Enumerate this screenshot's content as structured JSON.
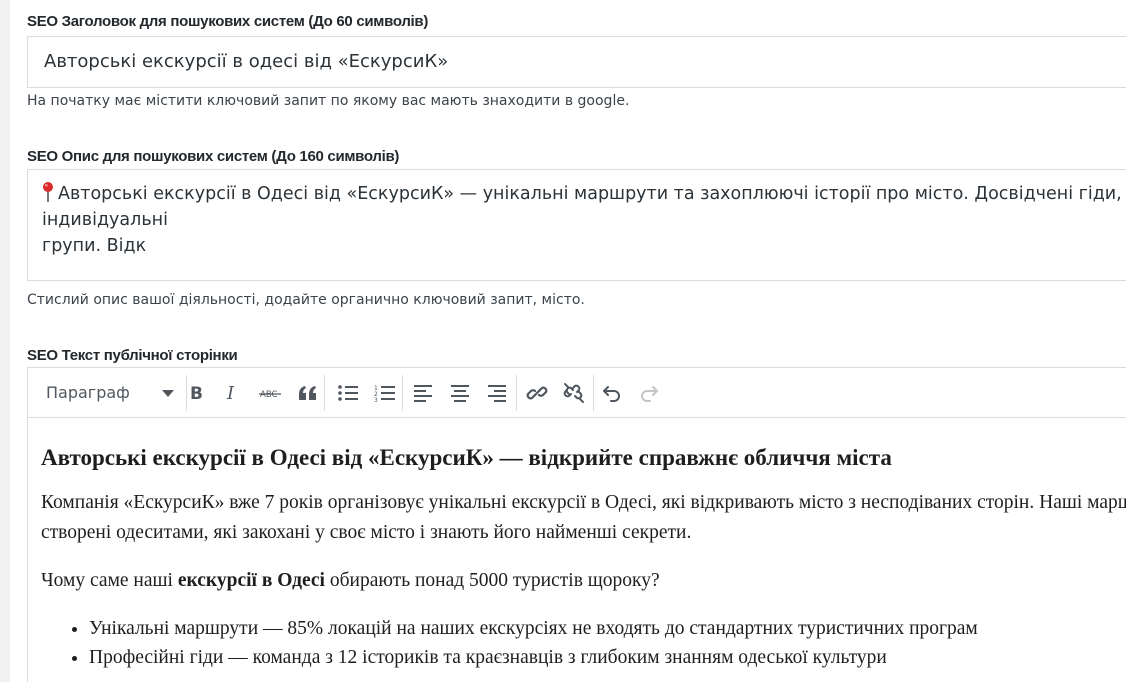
{
  "seo_title": {
    "label": "SEO Заголовок для пошукових систем (До 60 символів)",
    "value": "Авторські екскурсії в одесі від «ЕскурсиК»",
    "help": "На початку має містити ключовий запит по якому вас мають знаходити в google."
  },
  "seo_description": {
    "label": "SEO Опис для пошукових систем (До 160 символів)",
    "icon": "red-pin-icon",
    "value_line1": "Авторські екскурсії в Одесі від «ЕскурсиК» — унікальні маршрути та захоплюючі історії про місто. Досвідчені гіди, індивідуальні",
    "value_line2": "групи. Відк",
    "help": "Стислий опис вашої діяльності, додайте органично ключовий запит, місто."
  },
  "seo_text": {
    "label": "SEO Текст публічної сторінки",
    "toolbar": {
      "format_select": "Параграф",
      "buttons": [
        "bold-icon",
        "italic-icon",
        "strikethrough-icon",
        "blockquote-icon",
        "bullet-list-icon",
        "numbered-list-icon",
        "align-left-icon",
        "align-center-icon",
        "align-right-icon",
        "link-icon",
        "unlink-icon",
        "undo-icon",
        "redo-icon"
      ]
    },
    "content": {
      "heading": "Авторські екскурсії в Одесі від «ЕскурсиК» — відкрийте справжнє обличчя міста",
      "p1_line1": "Компанія «ЕскурсиК» вже 7 років організовує унікальні екскурсії в Одесі, які відкривають місто з несподіваних сторін. Наші маршрути",
      "p1_line2": "створені одеситами, які закохані у своє місто і знають його найменші секрети.",
      "p2_before": "Чому саме наші ",
      "p2_bold": "екскурсії в Одесі",
      "p2_after": " обирають понад 5000 туристів щороку?",
      "list": [
        "Унікальні маршрути — 85% локацій на наших екскурсіях не входять до стандартних туристичних програм",
        "Професійні гіди — команда з 12 істориків та краєзнавців з глибоким знанням одеської культури"
      ]
    }
  }
}
